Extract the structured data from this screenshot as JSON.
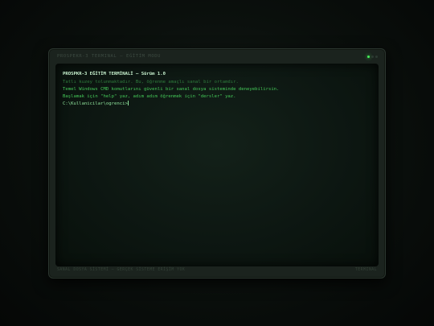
{
  "window": {
    "title": "PROSPEKR-3 TERMINAL — EĞİTİM MODU",
    "status_left": "SANAL DOSYA SİSTEMİ — GERÇEK SİSTEME ERİŞİM YOK",
    "status_right": "TERMINAL"
  },
  "terminal": {
    "header_name": "PROSPKR-3 EĞİTİM TERMİNALİ",
    "header_sep": "—",
    "header_version": "Sürüm 1.0",
    "lines": [
      "Tatlı kuzey tolunmaktadır. Bu, öğrenme amaçlı sanal bir ortamdır.",
      "Temel Windows CMD komutlarını güvenli bir sanal dosya sisteminde deneyebilirsin.",
      "Başlamak için \"help\" yaz, adım adım öğrenmek için \"dersler\" yaz."
    ],
    "prompt": "C:\\Kullanicilar\\ogrenci&gt;"
  },
  "colors": {
    "accent": "#46f05a",
    "text": "#44c958",
    "header": "#c8f2cf",
    "background": "#0d1712"
  },
  "icons": {
    "status_leds": "status-led-icon"
  }
}
